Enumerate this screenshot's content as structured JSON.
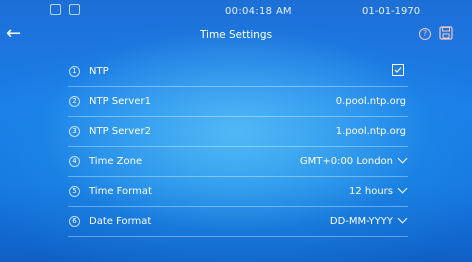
{
  "status_bar": {
    "time": "00:04:18",
    "ampm": "AM",
    "date": "01-01-1970"
  },
  "header": {
    "title": "Time Settings"
  },
  "settings": [
    {
      "num": "1",
      "label": "NTP",
      "type": "checkbox",
      "checked": true
    },
    {
      "num": "2",
      "label": "NTP Server1",
      "type": "text",
      "value": "0.pool.ntp.org"
    },
    {
      "num": "3",
      "label": "NTP Server2",
      "type": "text",
      "value": "1.pool.ntp.org"
    },
    {
      "num": "4",
      "label": "Time Zone",
      "type": "select",
      "value": "GMT+0:00 London"
    },
    {
      "num": "5",
      "label": "Time Format",
      "type": "select",
      "value": "12 hours"
    },
    {
      "num": "6",
      "label": "Date Format",
      "type": "select",
      "value": "DD-MM-YYYY"
    }
  ],
  "colors": {
    "background": "#1a7ee8",
    "help_icon": "#f3c6c6"
  }
}
